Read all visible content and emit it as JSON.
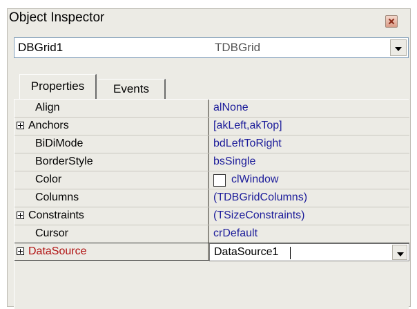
{
  "window": {
    "title": "Object Inspector"
  },
  "component_selector": {
    "name": "DBGrid1",
    "type": "TDBGrid"
  },
  "tabs": [
    {
      "label": "Properties",
      "active": true
    },
    {
      "label": "Events",
      "active": false
    }
  ],
  "properties": [
    {
      "name": "Align",
      "value": "alNone",
      "expandable": false
    },
    {
      "name": "Anchors",
      "value": "[akLeft,akTop]",
      "expandable": true
    },
    {
      "name": "BiDiMode",
      "value": "bdLeftToRight",
      "expandable": false
    },
    {
      "name": "BorderStyle",
      "value": "bsSingle",
      "expandable": false
    },
    {
      "name": "Color",
      "value": "clWindow",
      "expandable": false,
      "swatch_color": "#ffffff"
    },
    {
      "name": "Columns",
      "value": "(TDBGridColumns)",
      "expandable": false
    },
    {
      "name": "Constraints",
      "value": "(TSizeConstraints)",
      "expandable": true
    },
    {
      "name": "Cursor",
      "value": "crDefault",
      "expandable": false
    },
    {
      "name": "DataSource",
      "value": "DataSource1",
      "expandable": true,
      "selected": true
    }
  ],
  "colors": {
    "value_text": "#1c1c9a",
    "selected_name": "#b01010",
    "panel_bg": "#ecebe5"
  }
}
